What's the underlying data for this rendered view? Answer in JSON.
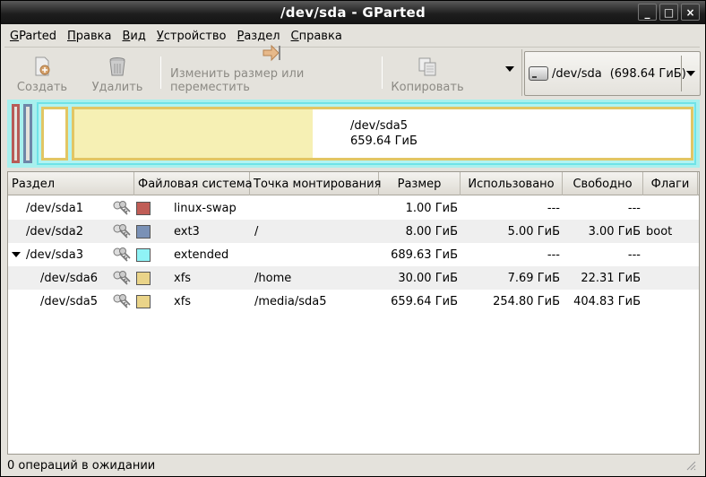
{
  "window": {
    "title": "/dev/sda - GParted",
    "buttons": {
      "minimize": "_",
      "maximize": "□",
      "close": "×"
    }
  },
  "menu": [
    {
      "label": "GParted",
      "mnemonic": "G"
    },
    {
      "label": "Правка",
      "mnemonic": "П"
    },
    {
      "label": "Вид",
      "mnemonic": "В"
    },
    {
      "label": "Устройство",
      "mnemonic": "У"
    },
    {
      "label": "Раздел",
      "mnemonic": "Р"
    },
    {
      "label": "Справка",
      "mnemonic": "С"
    }
  ],
  "toolbar": {
    "create": {
      "label": "Создать",
      "icon": "new-icon"
    },
    "delete": {
      "label": "Удалить",
      "icon": "trash-icon"
    },
    "resize": {
      "label": "Изменить размер или переместить",
      "icon": "resize-arrow-icon"
    },
    "copy": {
      "label": "Копировать",
      "icon": "copy-icon"
    }
  },
  "device": {
    "name": "/dev/sda",
    "size": "(698.64 ГиБ)"
  },
  "visual": {
    "selected_label": "/dev/sda5",
    "selected_size": "659.64 ГиБ",
    "sda5_used_fraction": 0.386
  },
  "table": {
    "columns": [
      "Раздел",
      "Файловая система",
      "Точка монтирования",
      "Размер",
      "Использовано",
      "Свободно",
      "Флаги"
    ],
    "rows": [
      {
        "partition": "/dev/sda1",
        "fs": "linux-swap",
        "color": "#c05d56",
        "mount": "",
        "size": "1.00 ГиБ",
        "used": "---",
        "free": "---",
        "flags": ""
      },
      {
        "partition": "/dev/sda2",
        "fs": "ext3",
        "color": "#7a91b6",
        "mount": "/",
        "size": "8.00 ГиБ",
        "used": "5.00 ГиБ",
        "free": "3.00 ГиБ",
        "flags": "boot"
      },
      {
        "partition": "/dev/sda3",
        "fs": "extended",
        "color": "#8ff3f6",
        "mount": "",
        "size": "689.63 ГиБ",
        "used": "---",
        "free": "---",
        "flags": ""
      },
      {
        "partition": "/dev/sda6",
        "fs": "xfs",
        "color": "#ead489",
        "mount": "/home",
        "size": "30.00 ГиБ",
        "used": "7.69 ГиБ",
        "free": "22.31 ГиБ",
        "flags": ""
      },
      {
        "partition": "/dev/sda5",
        "fs": "xfs",
        "color": "#ead489",
        "mount": "/media/sda5",
        "size": "659.64 ГиБ",
        "used": "254.80 ГиБ",
        "free": "404.83 ГиБ",
        "flags": ""
      }
    ]
  },
  "status": "0 операций в ожидании"
}
